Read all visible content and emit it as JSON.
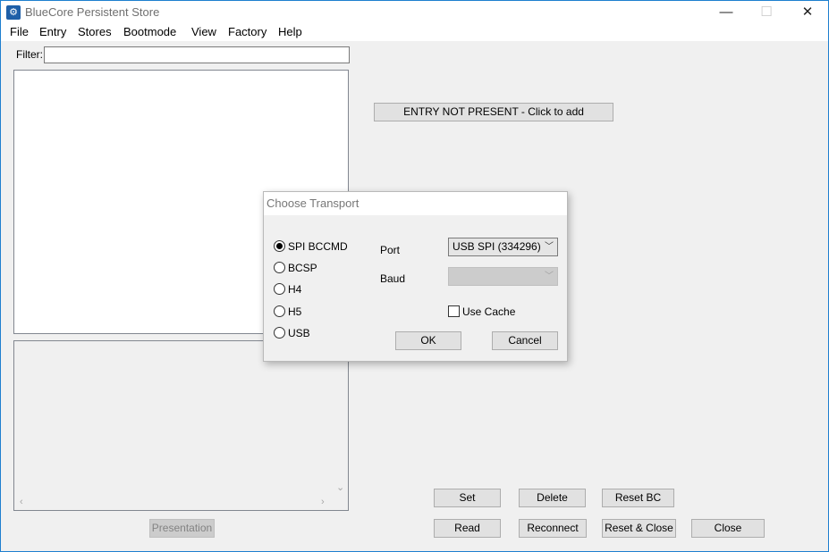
{
  "window": {
    "title": "BlueCore Persistent Store",
    "controls": {
      "minimize": "—",
      "maximize": "☐",
      "close": "✕"
    }
  },
  "menu": [
    "File",
    "Entry",
    "Stores",
    "Bootmode",
    "View",
    "Factory",
    "Help"
  ],
  "filter": {
    "label": "Filter:",
    "value": ""
  },
  "entry_button": "ENTRY NOT PRESENT - Click to add",
  "presentation_button": "Presentation",
  "buttons": {
    "set": "Set",
    "delete": "Delete",
    "reset_bc": "Reset BC",
    "read": "Read",
    "reconnect": "Reconnect",
    "reset_close": "Reset & Close",
    "close": "Close"
  },
  "dialog": {
    "title": "Choose Transport",
    "transports": [
      {
        "label": "SPI BCCMD",
        "checked": true
      },
      {
        "label": "BCSP",
        "checked": false
      },
      {
        "label": "H4",
        "checked": false
      },
      {
        "label": "H5",
        "checked": false
      },
      {
        "label": "USB",
        "checked": false
      }
    ],
    "port_label": "Port",
    "port_value": "USB SPI (334296)",
    "baud_label": "Baud",
    "baud_value": "",
    "use_cache_label": "Use Cache",
    "use_cache_checked": false,
    "ok": "OK",
    "cancel": "Cancel"
  },
  "colors": {
    "window_border": "#1e7fcf",
    "background": "#f0f0f0",
    "button_face": "#e1e1e1"
  }
}
